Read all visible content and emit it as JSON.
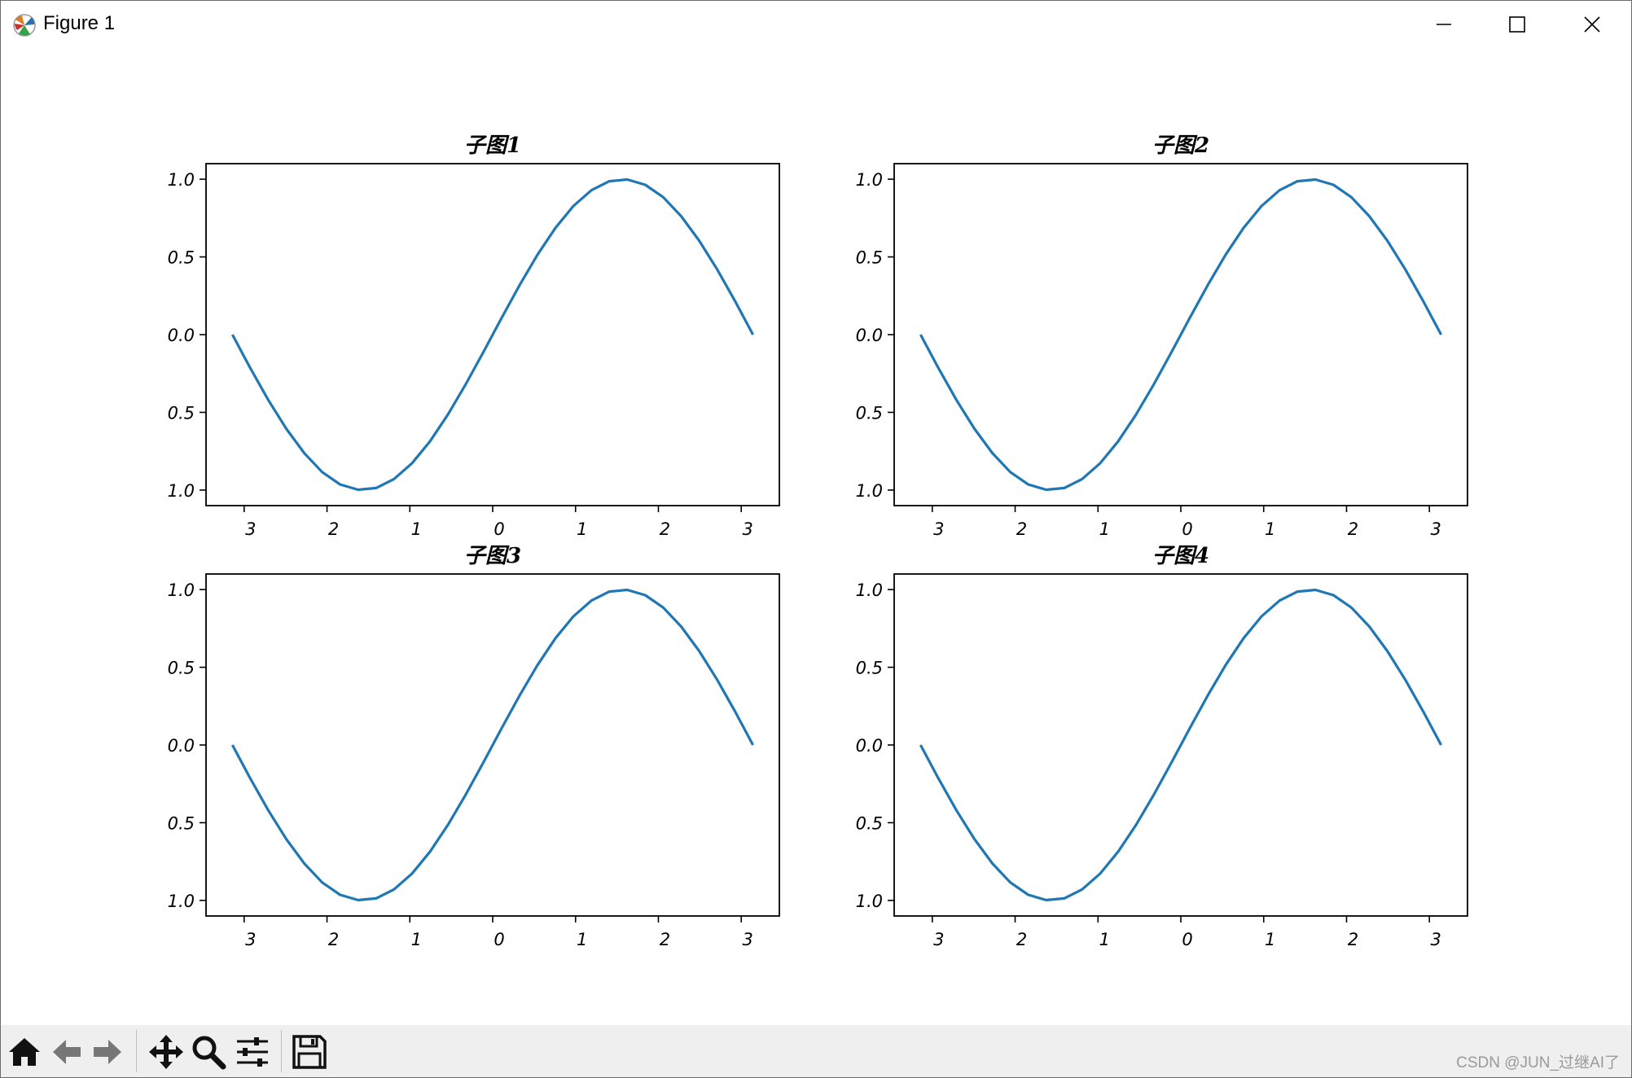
{
  "window": {
    "title": "Figure 1",
    "minimize_icon": "minimize-icon",
    "maximize_icon": "maximize-icon",
    "close_icon": "close-icon"
  },
  "toolbar": {
    "icons": [
      "home-icon",
      "back-icon",
      "forward-icon",
      "pan-icon",
      "zoom-icon",
      "configure-subplots-icon",
      "save-icon"
    ]
  },
  "watermark": "CSDN @JUN_过继AI了",
  "colors": {
    "line": "#1f77b4",
    "toolbar_bg": "#efefef"
  },
  "chart_data": [
    {
      "type": "line",
      "title": "子图1",
      "x_ticks": [
        -3,
        -2,
        -1,
        0,
        1,
        2,
        3
      ],
      "x_tick_labels": [
        "3",
        "2",
        "1",
        "0",
        "1",
        "2",
        "3"
      ],
      "y_ticks": [
        1.0,
        0.5,
        0.0,
        -0.5,
        -1.0
      ],
      "y_tick_labels": [
        "1.0",
        "0.5",
        "0.0",
        "0.5",
        "1.0"
      ],
      "xlim": [
        -3.46,
        3.46
      ],
      "ylim": [
        -1.1,
        1.1
      ],
      "series": [
        {
          "x": [
            -3.142,
            -2.925,
            -2.709,
            -2.492,
            -2.275,
            -2.058,
            -1.842,
            -1.625,
            -1.408,
            -1.192,
            -0.975,
            -0.758,
            -0.542,
            -0.325,
            -0.108,
            0.108,
            0.325,
            0.542,
            0.758,
            0.975,
            1.192,
            1.408,
            1.625,
            1.842,
            2.058,
            2.275,
            2.492,
            2.709,
            2.925,
            3.142
          ],
          "y": [
            0.0,
            -0.216,
            -0.42,
            -0.605,
            -0.762,
            -0.884,
            -0.964,
            -0.998,
            -0.987,
            -0.929,
            -0.828,
            -0.687,
            -0.515,
            -0.319,
            -0.108,
            0.108,
            0.319,
            0.515,
            0.687,
            0.828,
            0.929,
            0.987,
            0.998,
            0.964,
            0.884,
            0.762,
            0.605,
            0.42,
            0.216,
            0.0
          ]
        }
      ]
    },
    {
      "type": "line",
      "title": "子图2",
      "x_ticks": [
        -3,
        -2,
        -1,
        0,
        1,
        2,
        3
      ],
      "x_tick_labels": [
        "3",
        "2",
        "1",
        "0",
        "1",
        "2",
        "3"
      ],
      "y_ticks": [
        1.0,
        0.5,
        0.0,
        -0.5,
        -1.0
      ],
      "y_tick_labels": [
        "1.0",
        "0.5",
        "0.0",
        "0.5",
        "1.0"
      ],
      "xlim": [
        -3.46,
        3.46
      ],
      "ylim": [
        -1.1,
        1.1
      ],
      "series": [
        {
          "x": [
            -3.142,
            -2.925,
            -2.709,
            -2.492,
            -2.275,
            -2.058,
            -1.842,
            -1.625,
            -1.408,
            -1.192,
            -0.975,
            -0.758,
            -0.542,
            -0.325,
            -0.108,
            0.108,
            0.325,
            0.542,
            0.758,
            0.975,
            1.192,
            1.408,
            1.625,
            1.842,
            2.058,
            2.275,
            2.492,
            2.709,
            2.925,
            3.142
          ],
          "y": [
            0.0,
            -0.216,
            -0.42,
            -0.605,
            -0.762,
            -0.884,
            -0.964,
            -0.998,
            -0.987,
            -0.929,
            -0.828,
            -0.687,
            -0.515,
            -0.319,
            -0.108,
            0.108,
            0.319,
            0.515,
            0.687,
            0.828,
            0.929,
            0.987,
            0.998,
            0.964,
            0.884,
            0.762,
            0.605,
            0.42,
            0.216,
            0.0
          ]
        }
      ]
    },
    {
      "type": "line",
      "title": "子图3",
      "x_ticks": [
        -3,
        -2,
        -1,
        0,
        1,
        2,
        3
      ],
      "x_tick_labels": [
        "3",
        "2",
        "1",
        "0",
        "1",
        "2",
        "3"
      ],
      "y_ticks": [
        1.0,
        0.5,
        0.0,
        -0.5,
        -1.0
      ],
      "y_tick_labels": [
        "1.0",
        "0.5",
        "0.0",
        "0.5",
        "1.0"
      ],
      "xlim": [
        -3.46,
        3.46
      ],
      "ylim": [
        -1.1,
        1.1
      ],
      "series": [
        {
          "x": [
            -3.142,
            -2.925,
            -2.709,
            -2.492,
            -2.275,
            -2.058,
            -1.842,
            -1.625,
            -1.408,
            -1.192,
            -0.975,
            -0.758,
            -0.542,
            -0.325,
            -0.108,
            0.108,
            0.325,
            0.542,
            0.758,
            0.975,
            1.192,
            1.408,
            1.625,
            1.842,
            2.058,
            2.275,
            2.492,
            2.709,
            2.925,
            3.142
          ],
          "y": [
            0.0,
            -0.216,
            -0.42,
            -0.605,
            -0.762,
            -0.884,
            -0.964,
            -0.998,
            -0.987,
            -0.929,
            -0.828,
            -0.687,
            -0.515,
            -0.319,
            -0.108,
            0.108,
            0.319,
            0.515,
            0.687,
            0.828,
            0.929,
            0.987,
            0.998,
            0.964,
            0.884,
            0.762,
            0.605,
            0.42,
            0.216,
            0.0
          ]
        }
      ]
    },
    {
      "type": "line",
      "title": "子图4",
      "x_ticks": [
        -3,
        -2,
        -1,
        0,
        1,
        2,
        3
      ],
      "x_tick_labels": [
        "3",
        "2",
        "1",
        "0",
        "1",
        "2",
        "3"
      ],
      "y_ticks": [
        1.0,
        0.5,
        0.0,
        -0.5,
        -1.0
      ],
      "y_tick_labels": [
        "1.0",
        "0.5",
        "0.0",
        "0.5",
        "1.0"
      ],
      "xlim": [
        -3.46,
        3.46
      ],
      "ylim": [
        -1.1,
        1.1
      ],
      "series": [
        {
          "x": [
            -3.142,
            -2.925,
            -2.709,
            -2.492,
            -2.275,
            -2.058,
            -1.842,
            -1.625,
            -1.408,
            -1.192,
            -0.975,
            -0.758,
            -0.542,
            -0.325,
            -0.108,
            0.108,
            0.325,
            0.542,
            0.758,
            0.975,
            1.192,
            1.408,
            1.625,
            1.842,
            2.058,
            2.275,
            2.492,
            2.709,
            2.925,
            3.142
          ],
          "y": [
            0.0,
            -0.216,
            -0.42,
            -0.605,
            -0.762,
            -0.884,
            -0.964,
            -0.998,
            -0.987,
            -0.929,
            -0.828,
            -0.687,
            -0.515,
            -0.319,
            -0.108,
            0.108,
            0.319,
            0.515,
            0.687,
            0.828,
            0.929,
            0.987,
            0.998,
            0.964,
            0.884,
            0.762,
            0.605,
            0.42,
            0.216,
            0.0
          ]
        }
      ]
    }
  ]
}
